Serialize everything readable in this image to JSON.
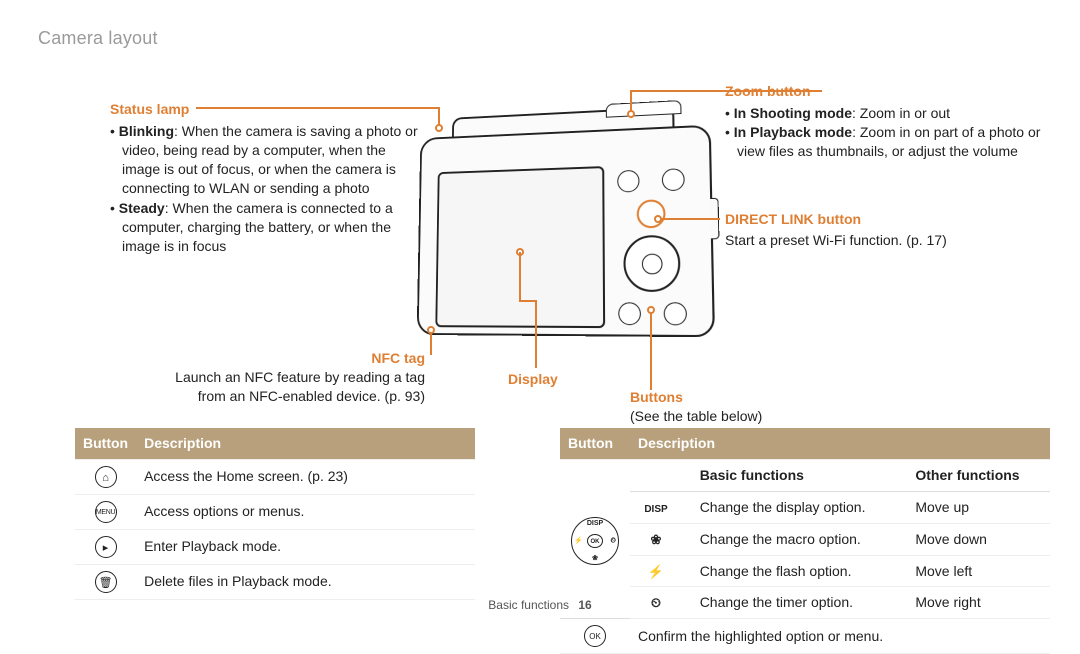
{
  "page": {
    "title": "Camera layout"
  },
  "callouts": {
    "status": {
      "title": "Status lamp",
      "blinking_label": "Blinking",
      "blinking_text": ": When the camera is saving a photo or video, being read by a computer, when the image is out of focus, or when the camera is connecting to WLAN or sending a photo",
      "steady_label": "Steady",
      "steady_text": ": When the camera is connected to a computer, charging the battery, or when the image is in focus"
    },
    "zoom": {
      "title": "Zoom button",
      "shoot_label": "In Shooting mode",
      "shoot_text": ": Zoom in or out",
      "play_label": "In Playback mode",
      "play_text": ": Zoom in on part of a photo or view files as thumbnails, or adjust the volume"
    },
    "directlink": {
      "title": "DIRECT LINK button",
      "sub": "Start a preset Wi-Fi function. (p. 17)"
    },
    "nfc": {
      "title": "NFC tag",
      "sub1": "Launch an NFC feature by reading a tag",
      "sub2": "from an NFC-enabled device. (p. 93)"
    },
    "display": {
      "title": "Display"
    },
    "buttons": {
      "title": "Buttons",
      "sub": "(See the table below)"
    }
  },
  "tables": {
    "left": {
      "headers": {
        "col1": "Button",
        "col2": "Description"
      },
      "rows": [
        {
          "icon_name": "home-icon",
          "glyph": "⌂",
          "desc": "Access the Home screen. (p. 23)"
        },
        {
          "icon_name": "menu-icon",
          "glyph": "MENU",
          "desc": "Access options or menus."
        },
        {
          "icon_name": "playback-icon",
          "glyph": "▸",
          "desc": "Enter Playback mode."
        },
        {
          "icon_name": "trash-icon",
          "glyph": "🗑",
          "desc": "Delete files in Playback mode."
        }
      ]
    },
    "right": {
      "headers": {
        "col1": "Button",
        "col2": "Description"
      },
      "subheaders": {
        "basic": "Basic functions",
        "other": "Other functions"
      },
      "navpad": {
        "disp": "DISP",
        "ok": "OK",
        "flash": "⚡",
        "timer": "⏲",
        "macro": "❀"
      },
      "rows": [
        {
          "icon_name": "disp-icon",
          "glyph": "DISP",
          "basic": "Change the display option.",
          "other": "Move up"
        },
        {
          "icon_name": "macro-icon",
          "glyph": "❀",
          "basic": "Change the macro option.",
          "other": "Move down"
        },
        {
          "icon_name": "flash-icon",
          "glyph": "⚡",
          "basic": "Change the flash option.",
          "other": "Move left"
        },
        {
          "icon_name": "timer-icon",
          "glyph": "⏲",
          "basic": "Change the timer option.",
          "other": "Move right"
        }
      ],
      "ok_row": {
        "icon_name": "ok-icon",
        "glyph": "OK",
        "desc": "Confirm the highlighted option or menu."
      }
    }
  },
  "footer": {
    "section": "Basic functions",
    "page": "16"
  }
}
